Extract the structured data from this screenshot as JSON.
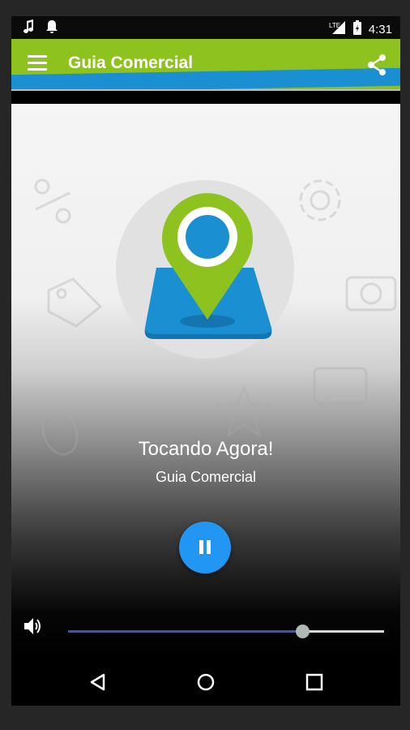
{
  "status_bar": {
    "time": "4:31",
    "network": "LTE",
    "left_icons": [
      "music-note-icon",
      "notification-bell-icon"
    ],
    "right_icons": [
      "lte-signal-icon",
      "battery-icon"
    ]
  },
  "app_bar": {
    "title": "Guia Comercial",
    "menu_icon": "hamburger-menu-icon",
    "share_icon": "share-icon",
    "colors": {
      "green": "#8dc21f",
      "blue": "#1a8fd1",
      "gray": "#b9bcc2"
    }
  },
  "player": {
    "now_playing_label": "Tocando Agora!",
    "station_name": "Guia Comercial",
    "state": "playing",
    "button_icon": "pause-icon",
    "button_color": "#2196f3",
    "volume_fraction": 0.74,
    "volume_icon": "volume-icon",
    "slider_fill_color": "#3f51b5"
  },
  "logo": {
    "icon": "map-pin-logo-icon",
    "pin_color": "#8dc21f",
    "map_color": "#1a8fd1"
  },
  "nav_bar": {
    "buttons": [
      "back-icon",
      "home-icon",
      "recents-icon"
    ]
  }
}
